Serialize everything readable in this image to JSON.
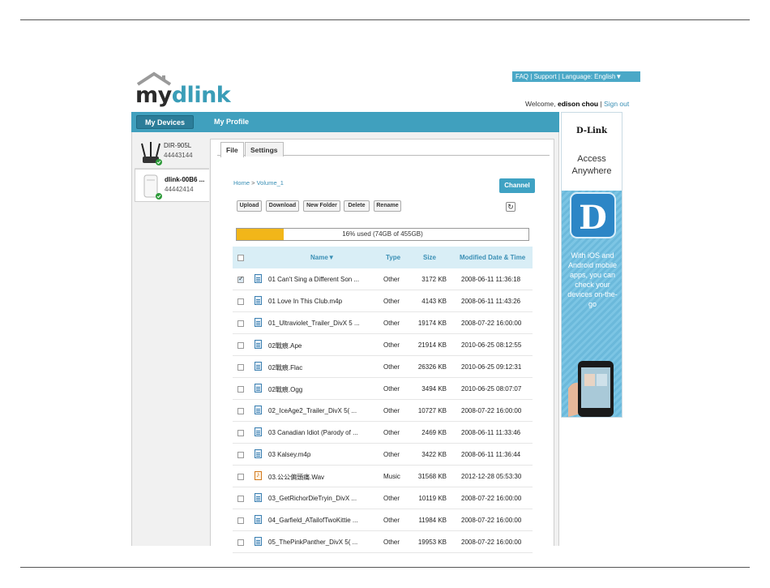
{
  "brand": {
    "logo_my": "my",
    "logo_dlink": "dlink"
  },
  "top_links": {
    "faq": "FAQ",
    "support": "Support",
    "language": "Language: English▼"
  },
  "account": {
    "welcome": "Welcome,",
    "user": "edison chou",
    "sign_out": "Sign out"
  },
  "nav": {
    "my_devices": "My Devices",
    "my_profile": "My Profile"
  },
  "devices": [
    {
      "name": "DIR-905L",
      "id": "44443144"
    },
    {
      "name": "dlink-00B6 ...",
      "id": "44442414"
    }
  ],
  "tabs": {
    "file": "File",
    "settings": "Settings"
  },
  "breadcrumb": {
    "home": "Home",
    "sep": ">",
    "volume": "Volume_1"
  },
  "channel_label": "Channel",
  "toolbar": {
    "upload": "Upload",
    "download": "Download",
    "new_folder": "New Folder",
    "delete": "Delete",
    "rename": "Rename"
  },
  "usage": {
    "text": "16% used (74GB of 455GB)",
    "percent": 16
  },
  "table": {
    "headers": {
      "name": "Name▼",
      "type": "Type",
      "size": "Size",
      "modified": "Modified Date & Time"
    },
    "rows": [
      {
        "name": "01 Can't Sing a Different Son ...",
        "type": "Other",
        "size": "3172 KB",
        "date": "2008-06-11 11:36:18",
        "icon": "document-icon",
        "checked": true
      },
      {
        "name": "01 Love In This Club.m4p",
        "type": "Other",
        "size": "4143 KB",
        "date": "2008-06-11 11:43:26",
        "icon": "document-icon",
        "checked": false
      },
      {
        "name": "01_Ultraviolet_Trailer_DivX 5 ...",
        "type": "Other",
        "size": "19174 KB",
        "date": "2008-07-22 16:00:00",
        "icon": "document-icon",
        "checked": false
      },
      {
        "name": "02戰痕.Ape",
        "type": "Other",
        "size": "21914 KB",
        "date": "2010-06-25 08:12:55",
        "icon": "document-icon",
        "checked": false
      },
      {
        "name": "02戰痕.Flac",
        "type": "Other",
        "size": "26326 KB",
        "date": "2010-06-25 09:12:31",
        "icon": "document-icon",
        "checked": false
      },
      {
        "name": "02戰痕.Ogg",
        "type": "Other",
        "size": "3494 KB",
        "date": "2010-06-25 08:07:07",
        "icon": "document-icon",
        "checked": false
      },
      {
        "name": "02_IceAge2_Trailer_DivX 5( ...",
        "type": "Other",
        "size": "10727 KB",
        "date": "2008-07-22 16:00:00",
        "icon": "document-icon",
        "checked": false
      },
      {
        "name": "03 Canadian Idiot (Parody of ...",
        "type": "Other",
        "size": "2469 KB",
        "date": "2008-06-11 11:33:46",
        "icon": "document-icon",
        "checked": false
      },
      {
        "name": "03 Kalsey.m4p",
        "type": "Other",
        "size": "3422 KB",
        "date": "2008-06-11 11:36:44",
        "icon": "document-icon",
        "checked": false
      },
      {
        "name": "03.公公偏頭痛.Wav",
        "type": "Music",
        "size": "31568 KB",
        "date": "2012-12-28 05:53:30",
        "icon": "music-file-icon",
        "checked": false
      },
      {
        "name": "03_GetRichorDieTryin_DivX ...",
        "type": "Other",
        "size": "10119 KB",
        "date": "2008-07-22 16:00:00",
        "icon": "document-icon",
        "checked": false
      },
      {
        "name": "04_Garfield_ATailofTwoKittie ...",
        "type": "Other",
        "size": "11984 KB",
        "date": "2008-07-22 16:00:00",
        "icon": "document-icon",
        "checked": false
      },
      {
        "name": "05_ThePinkPanther_DivX 5( ...",
        "type": "Other",
        "size": "19953 KB",
        "date": "2008-07-22 16:00:00",
        "icon": "document-icon",
        "checked": false
      }
    ]
  },
  "ad": {
    "brand": "D-Link",
    "tagline_1": "Access",
    "tagline_2": "Anywhere",
    "tile_letter": "D",
    "promo": "With iOS and Android mobile apps, you can check your devices on-the-go"
  },
  "colors": {
    "accent": "#40a0be",
    "usage_fill": "#f2b619",
    "link": "#3a8fb5"
  }
}
